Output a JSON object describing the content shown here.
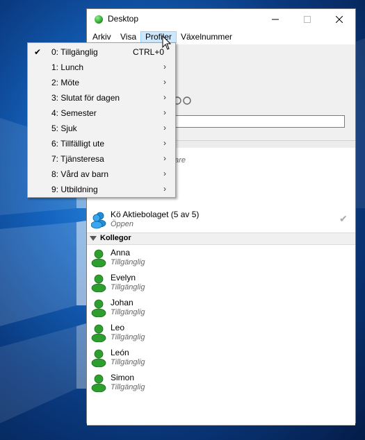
{
  "window": {
    "title": "Desktop"
  },
  "menubar": {
    "items": [
      "Arkiv",
      "Visa",
      "Profiler",
      "Växelnummer"
    ]
  },
  "dropdown": {
    "items": [
      {
        "label": "0: Tillgänglig",
        "checked": true,
        "shortcut": "CTRL+0",
        "submenu": false
      },
      {
        "label": "1: Lunch",
        "checked": false,
        "shortcut": "",
        "submenu": true
      },
      {
        "label": "2: Möte",
        "checked": false,
        "shortcut": "",
        "submenu": true
      },
      {
        "label": "3: Slutat för dagen",
        "checked": false,
        "shortcut": "",
        "submenu": true
      },
      {
        "label": "4: Semester",
        "checked": false,
        "shortcut": "",
        "submenu": true
      },
      {
        "label": "5: Sjuk",
        "checked": false,
        "shortcut": "",
        "submenu": true
      },
      {
        "label": "6: Tillfälligt ute",
        "checked": false,
        "shortcut": "",
        "submenu": true
      },
      {
        "label": "7: Tjänsteresa",
        "checked": false,
        "shortcut": "",
        "submenu": true
      },
      {
        "label": "8: Vård av barn",
        "checked": false,
        "shortcut": "",
        "submenu": true
      },
      {
        "label": "9: Utbildning",
        "checked": false,
        "shortcut": "",
        "submenu": true
      }
    ]
  },
  "list": {
    "partial_status": "gare",
    "queue": {
      "name": "Kö Aktiebolaget (5 av 5)",
      "status": "Öppen"
    },
    "group": {
      "label": "Kollegor"
    },
    "contacts": [
      {
        "name": "Anna",
        "status": "Tillgänglig"
      },
      {
        "name": "Evelyn",
        "status": "Tillgänglig"
      },
      {
        "name": "Johan",
        "status": "Tillgänglig"
      },
      {
        "name": "Leo",
        "status": "Tillgänglig"
      },
      {
        "name": "León",
        "status": "Tillgänglig"
      },
      {
        "name": "Simon",
        "status": "Tillgänglig"
      }
    ]
  },
  "colors": {
    "available": "#2e9e2e",
    "queue": "#1e8fd8",
    "menu_highlight": "#cce8ff"
  }
}
